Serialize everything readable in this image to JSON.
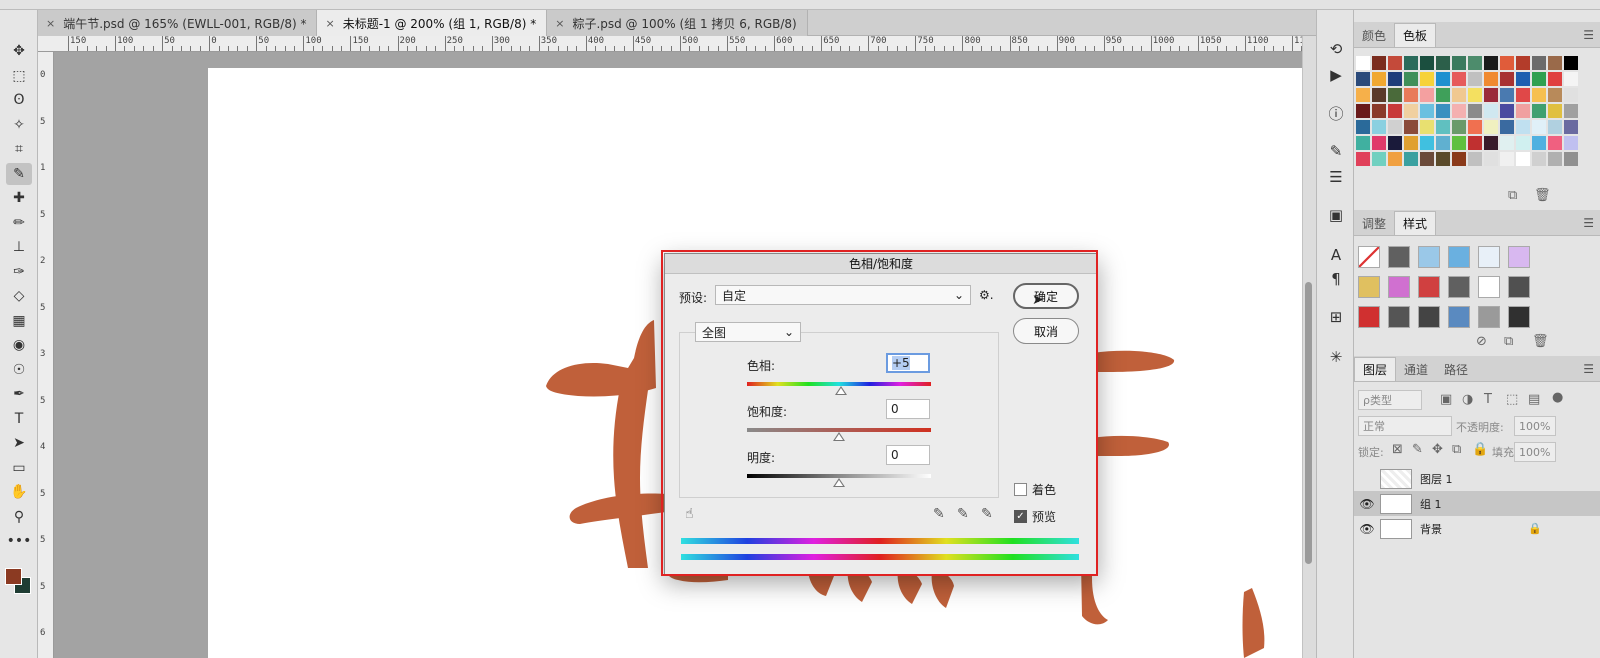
{
  "tabs": [
    {
      "label": "端午节.psd @ 165% (EWLL-001, RGB/8) *",
      "close": "×",
      "active": false
    },
    {
      "label": "未标题-1 @ 200% (组 1, RGB/8) *",
      "close": "×",
      "active": true
    },
    {
      "label": "粽子.psd @ 100% (组 1 拷贝 6, RGB/8)",
      "close": "×",
      "active": false
    }
  ],
  "ruler": {
    "h_labels": [
      "150",
      "100",
      "50",
      "0",
      "50",
      "100",
      "150",
      "200",
      "250",
      "300",
      "350",
      "400",
      "450",
      "500",
      "550",
      "600",
      "650",
      "700",
      "750",
      "800",
      "850",
      "900",
      "950",
      "1000",
      "1050",
      "1100",
      "115"
    ],
    "v_labels": [
      "0",
      "5",
      "1",
      "5",
      "2",
      "5",
      "3",
      "5",
      "4",
      "5",
      "5",
      "5",
      "6"
    ]
  },
  "toolbar": {
    "icons": [
      "move-icon",
      "marquee-icon",
      "lasso-icon",
      "magic-wand-icon",
      "crop-icon",
      "eyedropper-icon",
      "healing-brush-icon",
      "brush-icon",
      "stamp-icon",
      "history-brush-icon",
      "eraser-icon",
      "gradient-icon",
      "blur-icon",
      "dodge-icon",
      "pen-icon",
      "type-icon",
      "path-select-icon",
      "rectangle-icon",
      "hand-icon",
      "zoom-icon",
      "more-icon"
    ],
    "glyphs": [
      "✥",
      "⬚",
      "ʘ",
      "✧",
      "⌗",
      "✎",
      "✚",
      "✏",
      "⊥",
      "✑",
      "◇",
      "▦",
      "◉",
      "☉",
      "✒",
      "T",
      "➤",
      "▭",
      "✋",
      "⚲",
      "•••"
    ],
    "selected_index": 5,
    "foreground_color": "#8b3a22",
    "background_color": "#1f3d33"
  },
  "minicol": {
    "icons": [
      "history-icon",
      "play-icon",
      "info-icon",
      "brush-settings-icon",
      "adjust-icon",
      "library-icon",
      "character-icon",
      "paragraph-icon",
      "glyphs-icon",
      "spark-icon"
    ],
    "glyphs": [
      "⟲",
      "▶",
      "ⓘ",
      "✎",
      "☰",
      "▣",
      "A",
      "¶",
      "⊞",
      "✳"
    ]
  },
  "panels": {
    "swatch_tabs": [
      "颜色",
      "色板"
    ],
    "styles_tabs": [
      "调整",
      "样式"
    ],
    "layers_tabs": [
      "图层",
      "通道",
      "路径"
    ],
    "menu_icon": "☰"
  },
  "swatches": {
    "colors": [
      "#ffffff",
      "#7b2d1f",
      "#c44a3a",
      "#2b6b5b",
      "#1b4f3f",
      "#2c5f4a",
      "#3b7a5e",
      "#4d8c6c",
      "#1a1a1a",
      "#e05c3a",
      "#b33c2a",
      "#6b6b6b",
      "#9a6a4a",
      "#000000",
      "#2b4a7a",
      "#f0a830",
      "#1f3d7a",
      "#3f8f5a",
      "#f6d23a",
      "#1e90d0",
      "#e65a5a",
      "#c0c0c0",
      "#f08a30",
      "#a83232",
      "#1e5fb0",
      "#30a050",
      "#e04040",
      "#f4f4f4",
      "#f6b04a",
      "#5a3a2a",
      "#4a6a3a",
      "#e87a5a",
      "#f4a0a0",
      "#3fa05a",
      "#f0c890",
      "#f4e060",
      "#9a2a3a",
      "#4a7ab0",
      "#e04848",
      "#f6c050",
      "#b88a5a",
      "#e0e0e0",
      "#6a1a1a",
      "#8a3a2a",
      "#c83a3a",
      "#f0d0a0",
      "#6ac0e0",
      "#3a90c0",
      "#f4b0b0",
      "#8a8a8a",
      "#d0e8f0",
      "#4a4aa0",
      "#f0a0a0",
      "#40a070",
      "#e0c040",
      "#a0a0a0",
      "#2a6a9a",
      "#8ad0e0",
      "#d0d0d0",
      "#8a4a3a",
      "#e8e070",
      "#60c0c0",
      "#6a9a6a",
      "#f07050",
      "#f0f0c0",
      "#3a6aa0",
      "#c0e0f0",
      "#e0f0f8",
      "#b0d0e0",
      "#6a6aa0",
      "#40b0a0",
      "#e03a6a",
      "#1a1a3a",
      "#e0a030",
      "#40c0e0",
      "#60b0d0",
      "#60c040",
      "#c03030",
      "#3a1a2a",
      "#e0f0f0",
      "#d0f0f0",
      "#50b0e0",
      "#f06080",
      "#c0c0f0",
      "#e0405a",
      "#70d0c0",
      "#f0a040",
      "#3aa0a0",
      "#6a4a3a",
      "#5a4a2a",
      "#8a3a1a",
      "#c0c0c0",
      "#e0e0e0",
      "#f0f0f0",
      "#ffffff",
      "#d0d0d0",
      "#b0b0b0",
      "#909090"
    ]
  },
  "styles": {
    "swatches": [
      "#ffffff",
      "#606060",
      "#9ac8e8",
      "#6ab0e0",
      "#e8f0f8",
      "#d8b8f0",
      "#e0c060",
      "#d070d0",
      "#d04040",
      "#606060",
      "#ffffff",
      "#505050",
      "#d03030",
      "#555555",
      "#444444",
      "#5a8ac0",
      "#9a9a9a",
      "#303030"
    ]
  },
  "layers": {
    "filter_kind": "ρ类型",
    "blend_mode": "正常",
    "opacity_label": "不透明度:",
    "opacity_value": "100%",
    "lock_label": "锁定:",
    "fill_label": "填充:",
    "fill_value": "100%",
    "items": [
      {
        "name": "图层 1",
        "visible": false,
        "selected": false,
        "eye": ""
      },
      {
        "name": "组 1",
        "visible": true,
        "selected": true,
        "eye": "👁"
      },
      {
        "name": "背景",
        "visible": true,
        "selected": false,
        "eye": "👁",
        "lock": "🔒"
      }
    ]
  },
  "dialog": {
    "title": "色相/饱和度",
    "preset_label": "预设:",
    "preset_value": "自定",
    "gear": "⚙.",
    "ok_label": "确定",
    "cancel_label": "取消",
    "channel_value": "全图",
    "hue_label": "色相:",
    "hue_value": "+5",
    "hue_pct": 0.51,
    "saturation_label": "饱和度:",
    "saturation_value": "0",
    "saturation_pct": 0.5,
    "lightness_label": "明度:",
    "lightness_value": "0",
    "lightness_pct": 0.5,
    "colorize_label": "着色",
    "colorize_checked": false,
    "preview_label": "预览",
    "preview_checked": true,
    "dropdown_arrow": "⌄",
    "check_mark": "✓",
    "hand_icon": "☝",
    "eyedropper_glyph": "✎"
  }
}
